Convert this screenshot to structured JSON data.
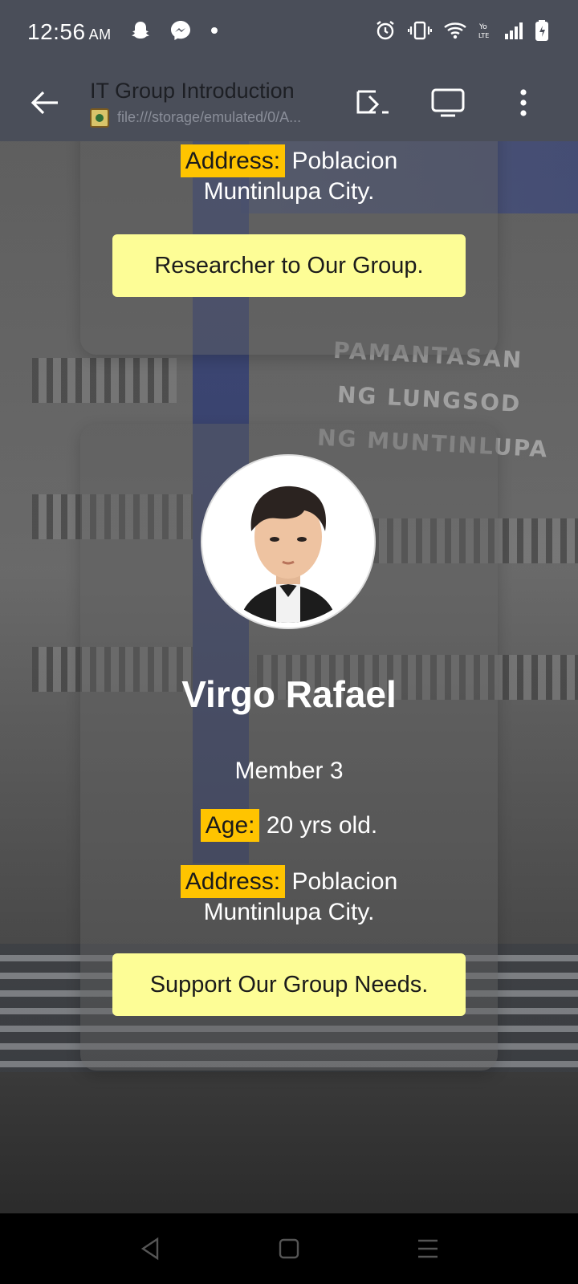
{
  "status_bar": {
    "time": "12:56",
    "ampm": "AM",
    "icons": [
      "snapchat-icon",
      "messenger-icon",
      "dot-icon",
      "alarm-icon",
      "vibrate-icon",
      "wifi-icon",
      "volte-icon",
      "signal-icon",
      "battery-icon"
    ]
  },
  "toolbar": {
    "title": "IT Group Introduction",
    "url": "file:///storage/emulated/0/A..."
  },
  "card_previous": {
    "address_label": "Address:",
    "address_line1": "Poblacion",
    "address_line2": "Muntinlupa City.",
    "button_label": "Researcher to Our Group."
  },
  "card_member": {
    "name": "Virgo Rafael",
    "member": "Member 3",
    "age_label": "Age:",
    "age_value": "20 yrs old.",
    "address_label": "Address:",
    "address_line1": "Poblacion",
    "address_line2": "Muntinlupa City.",
    "button_label": "Support Our Group Needs."
  },
  "background_sign": [
    "PAMANTASAN",
    "NG LUNGSOD",
    "NG MUNTINLUPA"
  ],
  "colors": {
    "status_bg": "#4a4e59",
    "label_chip": "#ffc400",
    "button_bg": "#fdfd96"
  }
}
